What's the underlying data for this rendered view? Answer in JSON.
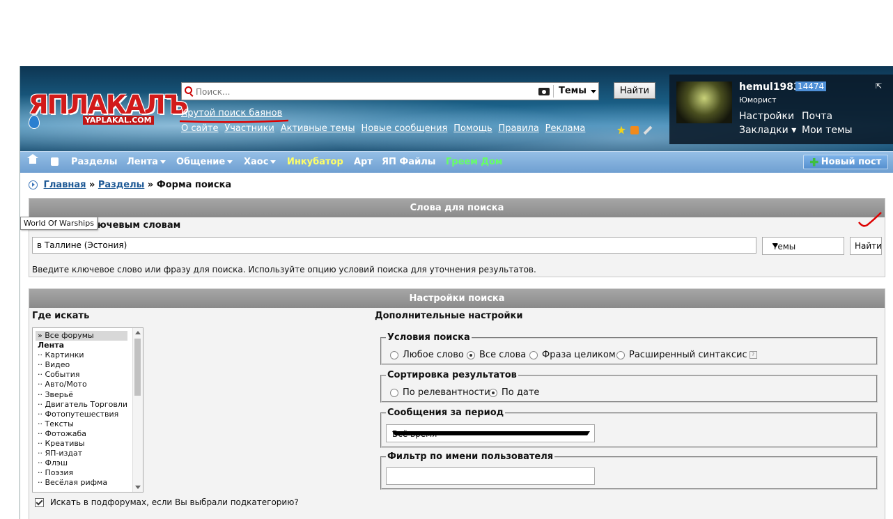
{
  "header": {
    "logo_text": "ЯПЛАКАЛЪ",
    "logo_sub": "YAPLAKAL.COM",
    "search_placeholder": "Поиск...",
    "search_scope": "Темы",
    "search_button": "Найти",
    "cool_search_link": "Крутой поиск баянов",
    "links": [
      "О сайте",
      "Участники",
      "Активные темы",
      "Новые сообщения",
      "Помощь",
      "Правила",
      "Реклама"
    ]
  },
  "user": {
    "name": "hemul1983",
    "count": "14474",
    "rank": "Юморист",
    "settings": "Настройки",
    "mail": "Почта",
    "bookmarks": "Закладки",
    "my_topics": "Мои темы"
  },
  "nav": {
    "items": [
      "Разделы",
      "Лента",
      "Общение",
      "Хаос",
      "Инкубатор",
      "Арт",
      "ЯП Файлы",
      "Греем Дом"
    ],
    "new_post": "Новый пост",
    "colors": {
      "incubator": "#ffff66",
      "greem": "#66ff66",
      "bar": "#7aa8d8"
    }
  },
  "breadcrumb": {
    "home": "Главная",
    "sections": "Разделы",
    "sep": "»",
    "current": "Форма поиска"
  },
  "keywords_panel": {
    "header": "Слова для поиска",
    "subheader": "…ючевым словам",
    "tooltip": "World Of Warships",
    "query_value": "в Таллине (Эстония)",
    "scope_value": "Темы",
    "find_button": "Найти",
    "hint": "Введите ключевое слово или фразу для поиска. Используйте опцию условий поиска для уточнения результатов."
  },
  "settings_panel": {
    "header": "Настройки поиска",
    "where_label": "Где искать",
    "extra_label": "Дополнительные настройки",
    "forums": [
      "» Все форумы",
      "Лента",
      "·· Картинки",
      "·· Видео",
      "·· События",
      "·· Авто/Мото",
      "·· Зверьё",
      "·· Двигатель Торговли",
      "·· Фотопутешествия",
      "·· Тексты",
      "·· Фотожаба",
      "·· Креативы",
      "·· ЯП-издат",
      "·· Флэш",
      "·· Поэзия",
      "·· Весёлая рифма"
    ],
    "subforums_checkbox": "Искать в подфорумах, если Вы выбрали подкатегорию?",
    "conditions_legend": "Условия поиска",
    "conditions": [
      "Любое слово",
      "Все слова",
      "Фраза целиком",
      "Расширенный синтаксис"
    ],
    "conditions_selected": "Все слова",
    "sort_legend": "Сортировка результатов",
    "sort": [
      "По релевантности",
      "По дате"
    ],
    "sort_selected": "По дате",
    "period_legend": "Сообщения за период",
    "period_value": "Всё время",
    "user_filter_legend": "Фильтр по имени пользователя",
    "help_mark": "?"
  }
}
